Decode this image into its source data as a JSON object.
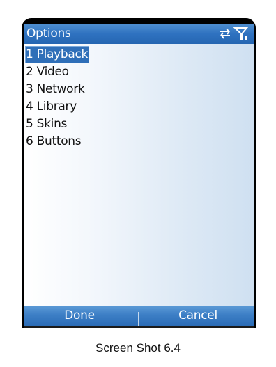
{
  "header": {
    "title": "Options",
    "status_icons": [
      "sync-icon",
      "signal-icon"
    ]
  },
  "menu": {
    "items": [
      {
        "label": "1 Playback",
        "selected": true
      },
      {
        "label": "2 Video",
        "selected": false
      },
      {
        "label": "3 Network",
        "selected": false
      },
      {
        "label": "4 Library",
        "selected": false
      },
      {
        "label": "5 Skins",
        "selected": false
      },
      {
        "label": "6 Buttons",
        "selected": false
      }
    ]
  },
  "softkeys": {
    "left": "Done",
    "right": "Cancel"
  },
  "caption": "Screen Shot 6.4",
  "colors": {
    "titlebar": "#2f72c0",
    "softbar": "#3d7fc6",
    "selection": "#2f6fb8"
  }
}
